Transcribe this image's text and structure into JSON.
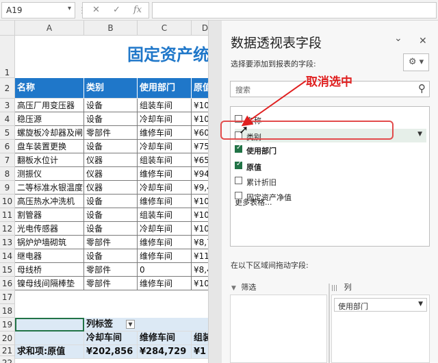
{
  "formula_bar": {
    "name_box": "A19",
    "cancel_icon": "✕",
    "enter_icon": "✓",
    "fx_label": "fx",
    "formula": ""
  },
  "sheet": {
    "columns": [
      "A",
      "B",
      "C",
      "D"
    ],
    "title_text": "固定资产统",
    "header_row": [
      "名称",
      "类别",
      "使用部门",
      "原值"
    ],
    "rows": [
      [
        "高压厂用变压器",
        "设备",
        "组装车间",
        "¥10"
      ],
      [
        "稳压源",
        "设备",
        "冷却车间",
        "¥10"
      ],
      [
        "螺旋板冷却器及闸阀",
        "零部件",
        "维修车间",
        "¥60"
      ],
      [
        "盘车装置更换",
        "设备",
        "冷却车间",
        "¥75"
      ],
      [
        "翻板水位计",
        "仪器",
        "组装车间",
        "¥65"
      ],
      [
        "测振仪",
        "仪器",
        "维修车间",
        "¥94"
      ],
      [
        "二等标准水银温度计",
        "仪器",
        "冷却车间",
        "¥9,4"
      ],
      [
        "高压热水冲洗机",
        "设备",
        "维修车间",
        "¥10"
      ],
      [
        "割管器",
        "设备",
        "组装车间",
        "¥10"
      ],
      [
        "光电传感器",
        "设备",
        "冷却车间",
        "¥10"
      ],
      [
        "锅炉炉墙砌筑",
        "零部件",
        "维修车间",
        "¥8,7"
      ],
      [
        "继电器",
        "设备",
        "维修车间",
        "¥11"
      ],
      [
        "母线桥",
        "零部件",
        "0",
        "¥8,4"
      ],
      [
        "镍母线间隔棒垫",
        "零部件",
        "维修车间",
        "¥10"
      ]
    ],
    "row_numbers": [
      "1",
      "2",
      "3",
      "4",
      "5",
      "6",
      "7",
      "8",
      "9",
      "10",
      "11",
      "12",
      "13",
      "14",
      "15",
      "16",
      "17",
      "18",
      "19",
      "20",
      "21",
      "22"
    ],
    "pivot": {
      "col_label": "列标签",
      "col_label_dropdown": "▼",
      "col_headers": [
        "冷却车间",
        "维修车间",
        "组装"
      ],
      "row_label": "求和项:原值",
      "values": [
        "¥202,856",
        "¥284,729",
        "¥1"
      ]
    }
  },
  "panel": {
    "title": "数据透视表字段",
    "dropdown_icon": "⌄",
    "close_icon": "✕",
    "subtitle": "选择要添加到报表的字段:",
    "settings_icon": "⚙ ▾",
    "search_placeholder": "搜索",
    "search_icon": "⚲",
    "fields": [
      {
        "label": "名称",
        "checked": false
      },
      {
        "label": "类别",
        "checked": false
      },
      {
        "label": "使用部门",
        "checked": true
      },
      {
        "label": "原值",
        "checked": true
      },
      {
        "label": "累计折旧",
        "checked": false
      },
      {
        "label": "固定资产净值",
        "checked": false
      }
    ],
    "field_dropdown_icon": "▼",
    "more_tables": "更多表格...",
    "areas_header": "在以下区域间拖动字段:",
    "filter_label": "筛选",
    "filter_icon": "▼",
    "columns_label": "列",
    "columns_icon": "|||",
    "column_field": "使用部门",
    "column_field_dropdown": "▼"
  },
  "annotation": {
    "text": "取消选中",
    "color": "#e02020"
  },
  "colors": {
    "header_fill": "#1f77c9",
    "title_text": "#1f77c9",
    "checked_box": "#217346",
    "pivot_fill": "#dce9f5"
  }
}
